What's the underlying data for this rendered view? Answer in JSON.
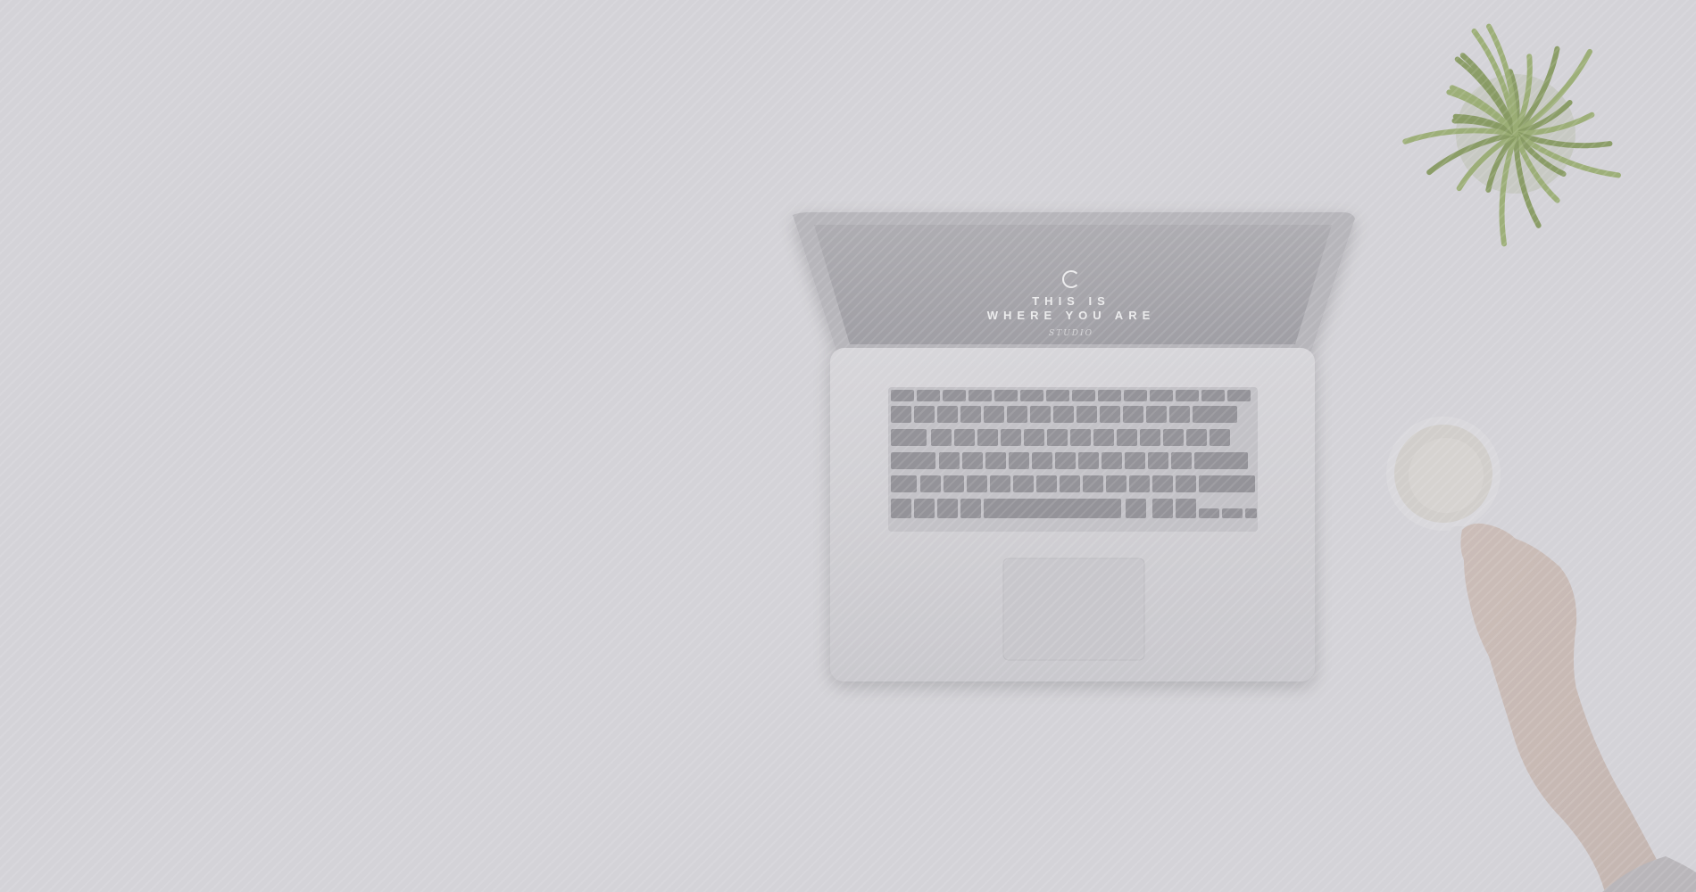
{
  "screen": {
    "title_line_1": "THIS IS",
    "title_line_2": "WHERE YOU ARE",
    "subtitle": "studio"
  },
  "colors": {
    "background": "#d4d3d8",
    "screen": "#a5a4aa",
    "laptop_body": "#cfced2",
    "keyboard": "#8f8e94",
    "plant": "#8ea06b",
    "hand": "#c6b9b5"
  }
}
